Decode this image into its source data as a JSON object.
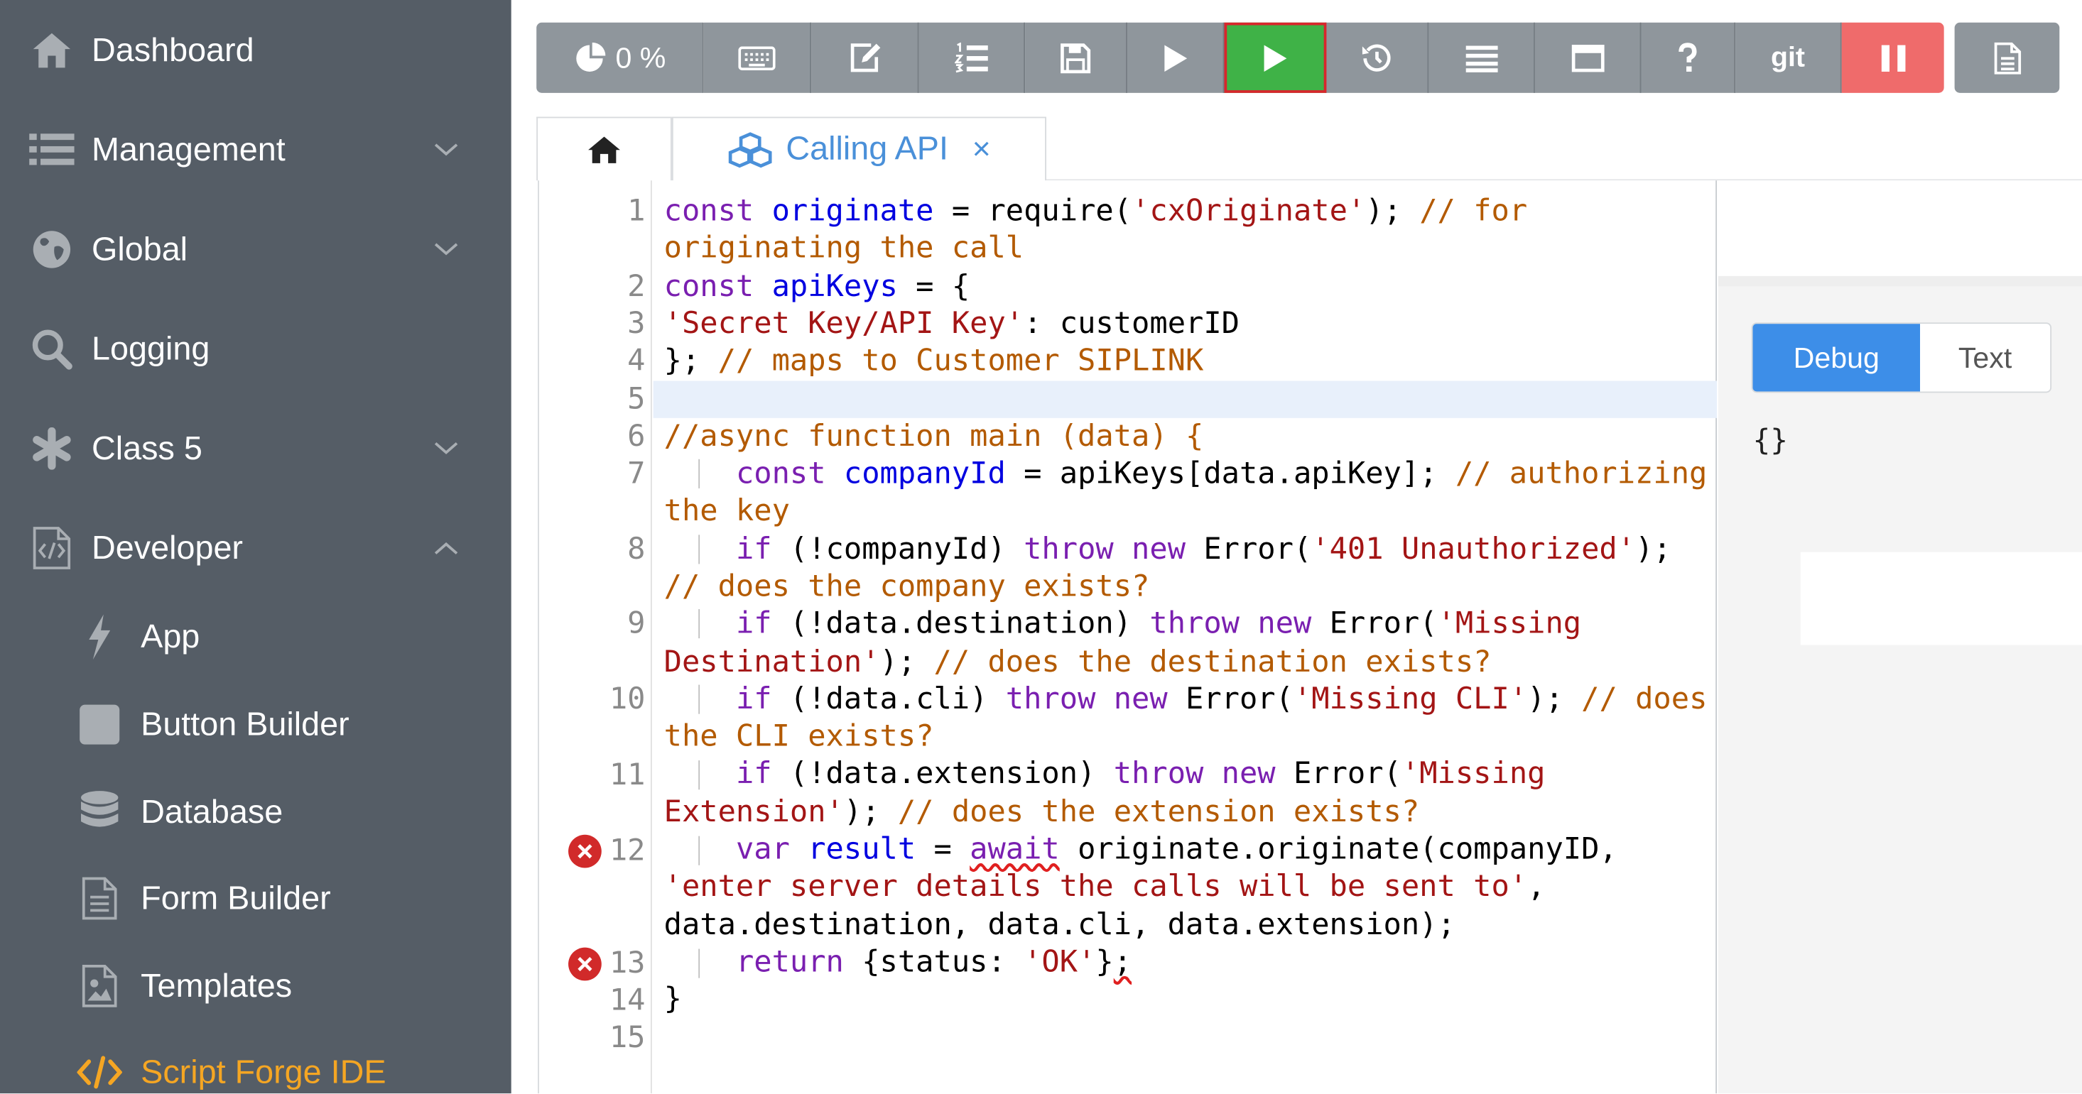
{
  "sidebar": {
    "items": [
      {
        "label": "Dashboard",
        "icon": "home-icon"
      },
      {
        "label": "Management",
        "icon": "list-icon"
      },
      {
        "label": "Global",
        "icon": "globe-icon"
      },
      {
        "label": "Logging",
        "icon": "search-icon"
      },
      {
        "label": "Class 5",
        "icon": "asterisk-icon"
      },
      {
        "label": "Developer",
        "icon": "code-file-icon"
      }
    ],
    "sub_items": [
      {
        "label": "App",
        "icon": "bolt-icon"
      },
      {
        "label": "Button Builder",
        "icon": "square-icon"
      },
      {
        "label": "Database",
        "icon": "database-icon"
      },
      {
        "label": "Form Builder",
        "icon": "form-icon"
      },
      {
        "label": "Templates",
        "icon": "image-file-icon"
      },
      {
        "label": "Script Forge IDE",
        "icon": "code-icon"
      }
    ]
  },
  "toolbar": {
    "progress_label": "0 %",
    "git_label": "git",
    "run_color": "#3fb247",
    "stop_color": "#ef6b6b"
  },
  "tabs": {
    "active_label": "Calling API",
    "close_label": "×"
  },
  "editor": {
    "line_numbers": [
      "1",
      "2",
      "3",
      "4",
      "5",
      "6",
      "7",
      "8",
      "9",
      "10",
      "11",
      "12",
      "13",
      "14",
      "15"
    ],
    "error_lines": [
      "12",
      "13"
    ]
  },
  "output": {
    "debug_label": "Debug",
    "text_label": "Text",
    "value": "{}"
  }
}
